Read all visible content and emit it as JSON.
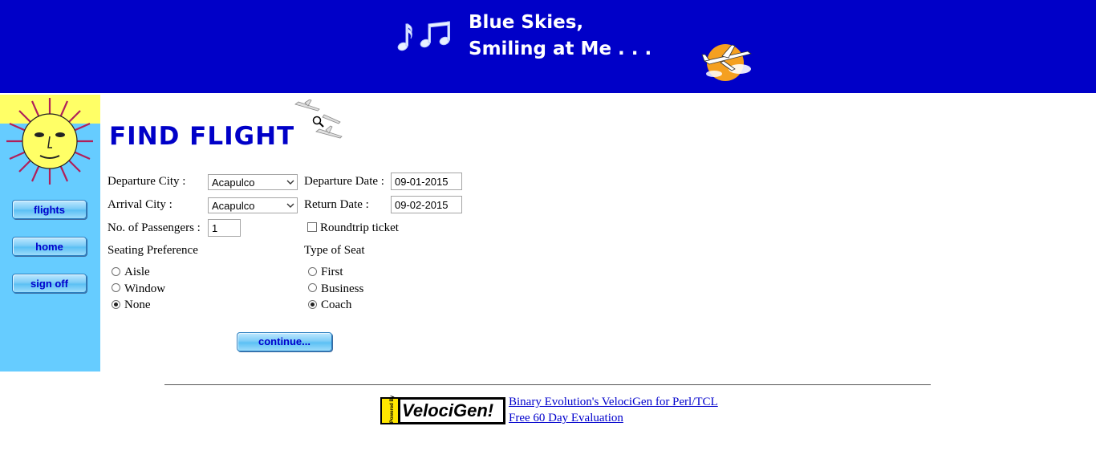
{
  "header": {
    "title_line1": "Blue Skies,",
    "title_line2": "Smiling at Me . . ."
  },
  "sidebar": {
    "items": [
      {
        "label": "flights"
      },
      {
        "label": "home"
      },
      {
        "label": "sign off"
      }
    ]
  },
  "main": {
    "title": "FIND FLIGHT",
    "form": {
      "departure_city_label": "Departure City :",
      "departure_city_value": "Acapulco",
      "departure_date_label": "Departure Date :",
      "departure_date_value": "09-01-2015",
      "arrival_city_label": "Arrival City :",
      "arrival_city_value": "Acapulco",
      "return_date_label": "Return Date :",
      "return_date_value": "09-02-2015",
      "passengers_label": "No. of Passengers :",
      "passengers_value": "1",
      "roundtrip_label": "Roundtrip ticket",
      "roundtrip_checked": false,
      "seating_pref_label": "Seating Preference",
      "seating_options": [
        {
          "label": "Aisle",
          "selected": false
        },
        {
          "label": "Window",
          "selected": false
        },
        {
          "label": "None",
          "selected": true
        }
      ],
      "seat_type_label": "Type of Seat",
      "seat_type_options": [
        {
          "label": "First",
          "selected": false
        },
        {
          "label": "Business",
          "selected": false
        },
        {
          "label": "Coach",
          "selected": true
        }
      ],
      "continue_label": "continue..."
    }
  },
  "footer": {
    "logo_powered_by": "Powered By",
    "logo_brand": "VelociGen!",
    "link1": "Binary Evolution's VelociGen for Perl/TCL",
    "link2": "Free 60 Day Evaluation"
  },
  "colors": {
    "banner": "#0000c8",
    "sidebar": "#66ccff",
    "title": "#0000c8",
    "link": "#0000cc"
  }
}
